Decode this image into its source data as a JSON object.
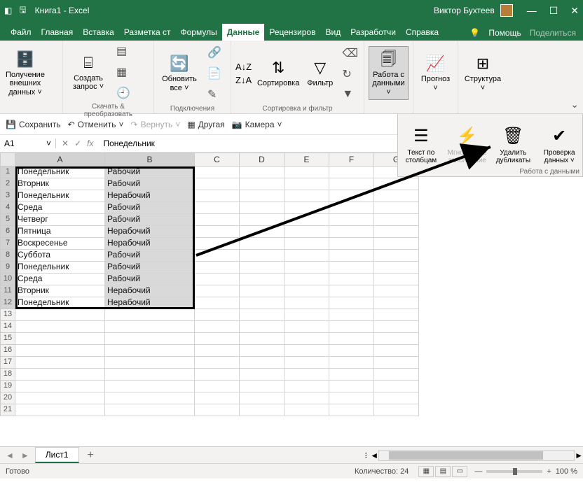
{
  "titlebar": {
    "title": "Книга1 - Excel",
    "user": "Виктор Бухтеев"
  },
  "tabs": {
    "file": "Файл",
    "home": "Главная",
    "insert": "Вставка",
    "layout": "Разметка ст",
    "formulas": "Формулы",
    "data": "Данные",
    "review": "Рецензиров",
    "view": "Вид",
    "developer": "Разработчи",
    "help": "Справка",
    "assist": "Помощь",
    "share": "Поделиться"
  },
  "ribbon": {
    "get_data": "Получение внешних данных ˅",
    "new_query": "Создать запрос ˅",
    "group_transform": "Скачать & преобразовать",
    "refresh": "Обновить все ˅",
    "group_connections": "Подключения",
    "sort": "Сортировка",
    "filter": "Фильтр",
    "group_sortfilter": "Сортировка и фильтр",
    "data_tools": "Работа с данными ˅",
    "forecast": "Прогноз ˅",
    "structure": "Структура ˅"
  },
  "qat": {
    "save": "Сохранить",
    "undo": "Отменить",
    "redo": "Вернуть",
    "other": "Другая",
    "camera": "Камера"
  },
  "datapanel": {
    "text_to_cols": "Текст по столбцам",
    "flash_fill": "Мгновенное заполнение",
    "remove_dupes": "Удалить дубликаты",
    "data_validation": "Проверка данных ˅",
    "footer": "Работа с данными"
  },
  "formula_bar": {
    "namebox": "A1",
    "formula": "Понедельник"
  },
  "columns": [
    "A",
    "B",
    "C",
    "D",
    "E",
    "F",
    "G"
  ],
  "data_rows": [
    [
      "Понедельник",
      "Рабочий"
    ],
    [
      "Вторник",
      "Рабочий"
    ],
    [
      "Понедельник",
      "Нерабочий"
    ],
    [
      "Среда",
      "Рабочий"
    ],
    [
      "Четверг",
      "Рабочий"
    ],
    [
      "Пятница",
      "Нерабочий"
    ],
    [
      "Воскресенье",
      "Нерабочий"
    ],
    [
      "Суббота",
      "Рабочий"
    ],
    [
      "Понедельник",
      "Рабочий"
    ],
    [
      "Среда",
      "Рабочий"
    ],
    [
      "Вторник",
      "Нерабочий"
    ],
    [
      "Понедельник",
      "Нерабочий"
    ]
  ],
  "sheet": {
    "name": "Лист1"
  },
  "status": {
    "ready": "Готово",
    "count": "Количество: 24",
    "zoom": "100 %"
  }
}
